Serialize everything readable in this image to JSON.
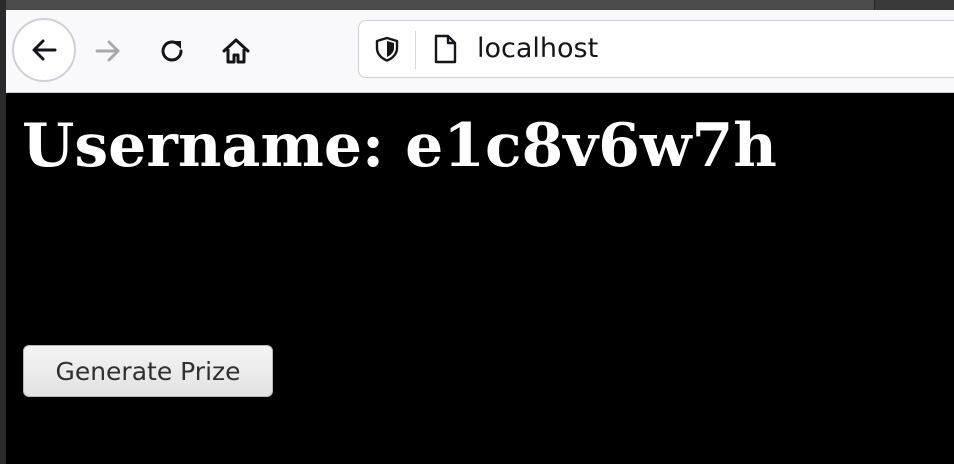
{
  "browser": {
    "url": "localhost",
    "nav": {
      "back_icon": "arrow-left-icon",
      "forward_icon": "arrow-right-icon",
      "reload_icon": "reload-icon",
      "home_icon": "home-icon"
    },
    "urlbar_icons": [
      "shield-icon",
      "page-icon"
    ]
  },
  "page": {
    "username_label": "Username: e1c8v6w7h",
    "generate_button_label": "Generate Prize"
  },
  "colors": {
    "page_background": "#000000",
    "heading_text": "#ffffff",
    "toolbar_background": "#f9f9fb"
  }
}
